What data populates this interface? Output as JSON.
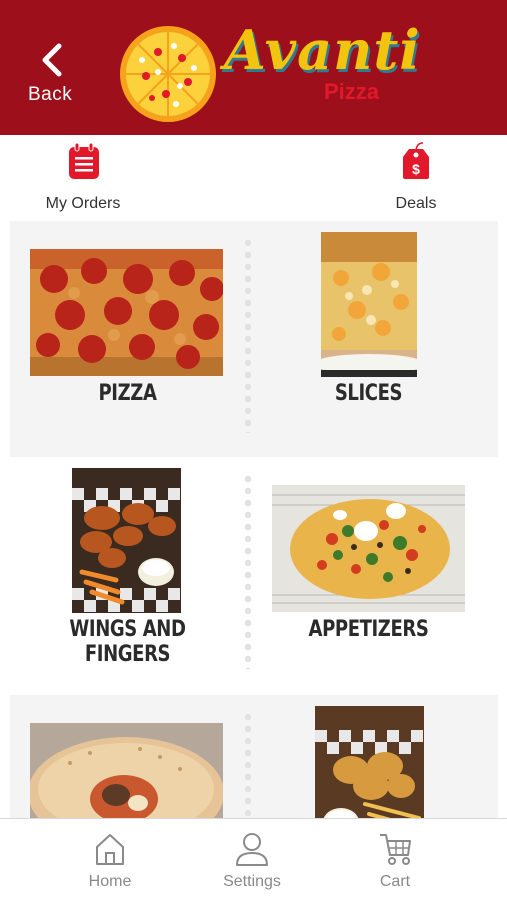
{
  "header": {
    "back_label": "Back",
    "brand_name": "Avanti",
    "brand_sub": "Pizza",
    "background_color": "#9d0f1a"
  },
  "quick_actions": {
    "orders_label": "My Orders",
    "deals_label": "Deals",
    "orders_icon": "calendar-list-icon",
    "deals_icon": "price-tag-icon",
    "accent": "#e2182b"
  },
  "categories": [
    {
      "label": "PIZZA",
      "icon": "pizza-photo"
    },
    {
      "label": "SLICES",
      "icon": "slice-photo"
    },
    {
      "label": "WINGS AND FINGERS",
      "icon": "wings-photo"
    },
    {
      "label": "APPETIZERS",
      "icon": "nachos-photo"
    },
    {
      "label": "",
      "icon": "calzone-photo"
    },
    {
      "label": "",
      "icon": "chicken-fries-photo"
    }
  ],
  "tabbar": {
    "home_label": "Home",
    "settings_label": "Settings",
    "cart_label": "Cart"
  }
}
